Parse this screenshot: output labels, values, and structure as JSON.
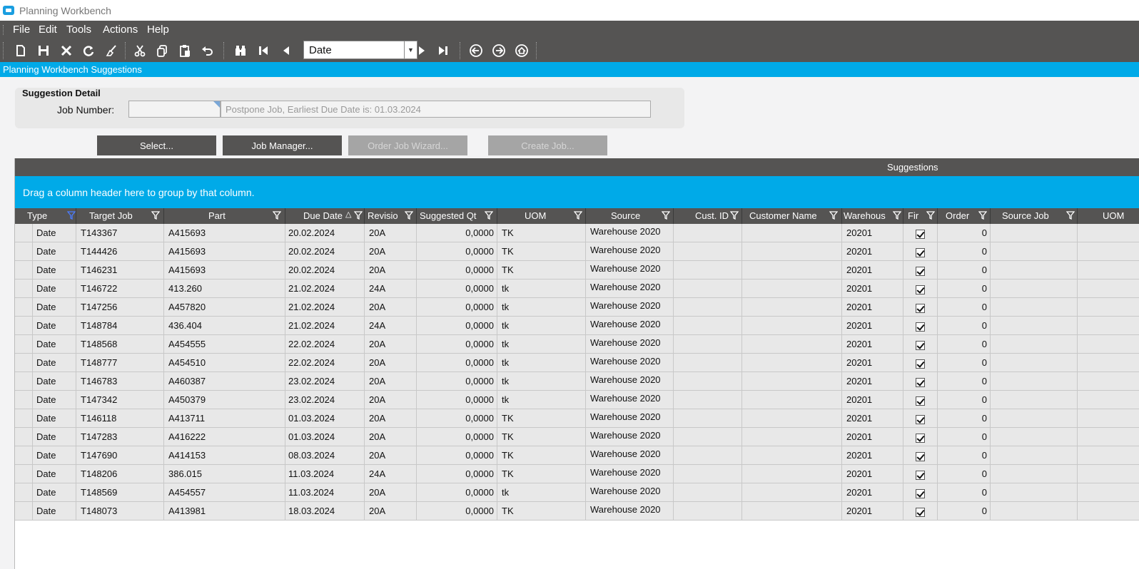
{
  "window": {
    "title": "Planning Workbench"
  },
  "menubar": [
    "File",
    "Edit",
    "Tools",
    "Actions",
    "Help"
  ],
  "toolbar": {
    "navigator_value": "Date"
  },
  "panel_title": "Planning Workbench Suggestions",
  "detail": {
    "header": "Suggestion Detail",
    "job_number_label": "Job Number:",
    "job_number_value": "",
    "message": "Postpone Job, Earliest Due Date is: 01.03.2024"
  },
  "buttons": {
    "select": "Select...",
    "job_manager": "Job Manager...",
    "order_job_wizard": "Order Job Wizard...",
    "create_job": "Create Job..."
  },
  "grid": {
    "title": "Suggestions",
    "group_hint": "Drag a column header here to group by that column.",
    "columns": [
      "Type",
      "Target Job",
      "Part",
      "Due Date",
      "Revisio",
      "Suggested Qt",
      "UOM",
      "Source",
      "Cust. ID",
      "Customer Name",
      "Warehous",
      "Fir",
      "Order",
      "Source Job",
      "UOM"
    ],
    "rows": [
      {
        "type": "Date",
        "target_job": "T143367",
        "part": "A415693",
        "due_date": "20.02.2024",
        "revision": "20A",
        "qty": "0,0000",
        "uom": "TK",
        "source": "Warehouse 2020",
        "cust_id": "",
        "customer_name": "",
        "warehouse": "20201",
        "firm": true,
        "order": "0"
      },
      {
        "type": "Date",
        "target_job": "T144426",
        "part": "A415693",
        "due_date": "20.02.2024",
        "revision": "20A",
        "qty": "0,0000",
        "uom": "TK",
        "source": "Warehouse 2020",
        "cust_id": "",
        "customer_name": "",
        "warehouse": "20201",
        "firm": true,
        "order": "0"
      },
      {
        "type": "Date",
        "target_job": "T146231",
        "part": "A415693",
        "due_date": "20.02.2024",
        "revision": "20A",
        "qty": "0,0000",
        "uom": "TK",
        "source": "Warehouse 2020",
        "cust_id": "",
        "customer_name": "",
        "warehouse": "20201",
        "firm": true,
        "order": "0"
      },
      {
        "type": "Date",
        "target_job": "T146722",
        "part": "413.260",
        "due_date": "21.02.2024",
        "revision": "24A",
        "qty": "0,0000",
        "uom": "tk",
        "source": "Warehouse 2020",
        "cust_id": "",
        "customer_name": "",
        "warehouse": "20201",
        "firm": true,
        "order": "0"
      },
      {
        "type": "Date",
        "target_job": "T147256",
        "part": "A457820",
        "due_date": "21.02.2024",
        "revision": "20A",
        "qty": "0,0000",
        "uom": "tk",
        "source": "Warehouse 2020",
        "cust_id": "",
        "customer_name": "",
        "warehouse": "20201",
        "firm": true,
        "order": "0"
      },
      {
        "type": "Date",
        "target_job": "T148784",
        "part": "436.404",
        "due_date": "21.02.2024",
        "revision": "24A",
        "qty": "0,0000",
        "uom": "tk",
        "source": "Warehouse 2020",
        "cust_id": "",
        "customer_name": "",
        "warehouse": "20201",
        "firm": true,
        "order": "0"
      },
      {
        "type": "Date",
        "target_job": "T148568",
        "part": "A454555",
        "due_date": "22.02.2024",
        "revision": "20A",
        "qty": "0,0000",
        "uom": "tk",
        "source": "Warehouse 2020",
        "cust_id": "",
        "customer_name": "",
        "warehouse": "20201",
        "firm": true,
        "order": "0"
      },
      {
        "type": "Date",
        "target_job": "T148777",
        "part": "A454510",
        "due_date": "22.02.2024",
        "revision": "20A",
        "qty": "0,0000",
        "uom": "tk",
        "source": "Warehouse 2020",
        "cust_id": "",
        "customer_name": "",
        "warehouse": "20201",
        "firm": true,
        "order": "0"
      },
      {
        "type": "Date",
        "target_job": "T146783",
        "part": "A460387",
        "due_date": "23.02.2024",
        "revision": "20A",
        "qty": "0,0000",
        "uom": "tk",
        "source": "Warehouse 2020",
        "cust_id": "",
        "customer_name": "",
        "warehouse": "20201",
        "firm": true,
        "order": "0"
      },
      {
        "type": "Date",
        "target_job": "T147342",
        "part": "A450379",
        "due_date": "23.02.2024",
        "revision": "20A",
        "qty": "0,0000",
        "uom": "tk",
        "source": "Warehouse 2020",
        "cust_id": "",
        "customer_name": "",
        "warehouse": "20201",
        "firm": true,
        "order": "0"
      },
      {
        "type": "Date",
        "target_job": "T146118",
        "part": "A413711",
        "due_date": "01.03.2024",
        "revision": "20A",
        "qty": "0,0000",
        "uom": "TK",
        "source": "Warehouse 2020",
        "cust_id": "",
        "customer_name": "",
        "warehouse": "20201",
        "firm": true,
        "order": "0"
      },
      {
        "type": "Date",
        "target_job": "T147283",
        "part": "A416222",
        "due_date": "01.03.2024",
        "revision": "20A",
        "qty": "0,0000",
        "uom": "TK",
        "source": "Warehouse 2020",
        "cust_id": "",
        "customer_name": "",
        "warehouse": "20201",
        "firm": true,
        "order": "0"
      },
      {
        "type": "Date",
        "target_job": "T147690",
        "part": "A414153",
        "due_date": "08.03.2024",
        "revision": "20A",
        "qty": "0,0000",
        "uom": "TK",
        "source": "Warehouse 2020",
        "cust_id": "",
        "customer_name": "",
        "warehouse": "20201",
        "firm": true,
        "order": "0"
      },
      {
        "type": "Date",
        "target_job": "T148206",
        "part": "386.015",
        "due_date": "11.03.2024",
        "revision": "24A",
        "qty": "0,0000",
        "uom": "TK",
        "source": "Warehouse 2020",
        "cust_id": "",
        "customer_name": "",
        "warehouse": "20201",
        "firm": true,
        "order": "0"
      },
      {
        "type": "Date",
        "target_job": "T148569",
        "part": "A454557",
        "due_date": "11.03.2024",
        "revision": "20A",
        "qty": "0,0000",
        "uom": "tk",
        "source": "Warehouse 2020",
        "cust_id": "",
        "customer_name": "",
        "warehouse": "20201",
        "firm": true,
        "order": "0"
      },
      {
        "type": "Date",
        "target_job": "T148073",
        "part": "A413981",
        "due_date": "18.03.2024",
        "revision": "20A",
        "qty": "0,0000",
        "uom": "TK",
        "source": "Warehouse 2020",
        "cust_id": "",
        "customer_name": "",
        "warehouse": "20201",
        "firm": true,
        "order": "0"
      }
    ]
  }
}
